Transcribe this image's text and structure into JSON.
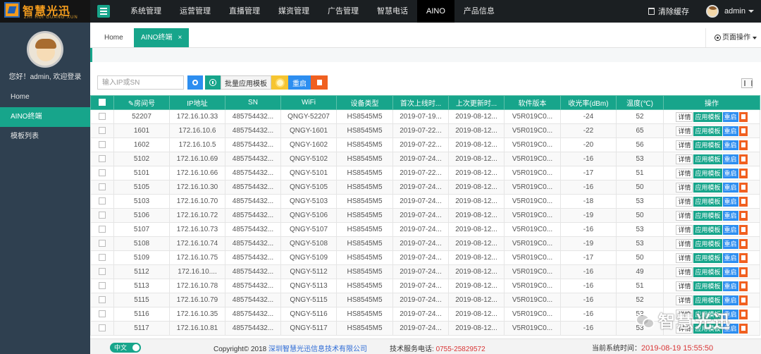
{
  "brand": {
    "name": "智慧光迅",
    "sub": "ZHI HUI GUANG XUN"
  },
  "nav": [
    {
      "label": "系统管理"
    },
    {
      "label": "运营管理"
    },
    {
      "label": "直播管理"
    },
    {
      "label": "媒资管理"
    },
    {
      "label": "广告管理"
    },
    {
      "label": "智慧电话"
    },
    {
      "label": "AINO"
    },
    {
      "label": "产品信息"
    }
  ],
  "nav_active": "AINO",
  "header": {
    "clear_cache": "清除缓存",
    "user": "admin"
  },
  "sidebar": {
    "greeting": "您好！admin, 欢迎登录",
    "items": [
      {
        "label": "Home"
      },
      {
        "label": "AINO终端"
      },
      {
        "label": "模板列表"
      }
    ]
  },
  "tabs": {
    "home": "Home",
    "aino": "AINO终端",
    "close": "×",
    "page_ops": "页面操作"
  },
  "toolbar": {
    "search_placeholder": "输入IP或SN",
    "batch_template": "批量应用模板",
    "reboot": "重启"
  },
  "table": {
    "columns": [
      "房间号",
      "IP地址",
      "SN",
      "WiFi",
      "设备类型",
      "首次上线时...",
      "上次更新时...",
      "软件版本",
      "收光率(dBm)",
      "温度(℃)",
      "操作"
    ],
    "actions": {
      "detail": "详情",
      "apply": "应用模板",
      "reboot": "重启"
    },
    "rows": [
      [
        "52207",
        "172.16.10.33",
        "485754432...",
        "QNGY-52207",
        "HS8545M5",
        "2019-07-19...",
        "2019-08-12...",
        "V5R019C0...",
        "-24",
        "52"
      ],
      [
        "1601",
        "172.16.10.6",
        "485754432...",
        "QNGY-1601",
        "HS8545M5",
        "2019-07-22...",
        "2019-08-12...",
        "V5R019C0...",
        "-22",
        "65"
      ],
      [
        "1602",
        "172.16.10.5",
        "485754432...",
        "QNGY-1602",
        "HS8545M5",
        "2019-07-22...",
        "2019-08-12...",
        "V5R019C0...",
        "-20",
        "56"
      ],
      [
        "5102",
        "172.16.10.69",
        "485754432...",
        "QNGY-5102",
        "HS8545M5",
        "2019-07-24...",
        "2019-08-12...",
        "V5R019C0...",
        "-16",
        "53"
      ],
      [
        "5101",
        "172.16.10.66",
        "485754432...",
        "QNGY-5101",
        "HS8545M5",
        "2019-07-22...",
        "2019-08-12...",
        "V5R019C0...",
        "-17",
        "51"
      ],
      [
        "5105",
        "172.16.10.30",
        "485754432...",
        "QNGY-5105",
        "HS8545M5",
        "2019-07-24...",
        "2019-08-12...",
        "V5R019C0...",
        "-16",
        "50"
      ],
      [
        "5103",
        "172.16.10.70",
        "485754432...",
        "QNGY-5103",
        "HS8545M5",
        "2019-07-24...",
        "2019-08-12...",
        "V5R019C0...",
        "-18",
        "53"
      ],
      [
        "5106",
        "172.16.10.72",
        "485754432...",
        "QNGY-5106",
        "HS8545M5",
        "2019-07-24...",
        "2019-08-12...",
        "V5R019C0...",
        "-19",
        "50"
      ],
      [
        "5107",
        "172.16.10.73",
        "485754432...",
        "QNGY-5107",
        "HS8545M5",
        "2019-07-24...",
        "2019-08-12...",
        "V5R019C0...",
        "-16",
        "53"
      ],
      [
        "5108",
        "172.16.10.74",
        "485754432...",
        "QNGY-5108",
        "HS8545M5",
        "2019-07-24...",
        "2019-08-12...",
        "V5R019C0...",
        "-19",
        "53"
      ],
      [
        "5109",
        "172.16.10.75",
        "485754432...",
        "QNGY-5109",
        "HS8545M5",
        "2019-07-24...",
        "2019-08-12...",
        "V5R019C0...",
        "-17",
        "50"
      ],
      [
        "5112",
        "172.16.10....",
        "485754432...",
        "QNGY-5112",
        "HS8545M5",
        "2019-07-24...",
        "2019-08-12...",
        "V5R019C0...",
        "-16",
        "49"
      ],
      [
        "5113",
        "172.16.10.78",
        "485754432...",
        "QNGY-5113",
        "HS8545M5",
        "2019-07-24...",
        "2019-08-12...",
        "V5R019C0...",
        "-16",
        "51"
      ],
      [
        "5115",
        "172.16.10.79",
        "485754432...",
        "QNGY-5115",
        "HS8545M5",
        "2019-07-24...",
        "2019-08-12...",
        "V5R019C0...",
        "-16",
        "52"
      ],
      [
        "5116",
        "172.16.10.35",
        "485754432...",
        "QNGY-5116",
        "HS8545M5",
        "2019-07-24...",
        "2019-08-12...",
        "V5R019C0...",
        "-16",
        "53"
      ],
      [
        "5117",
        "172.16.10.81",
        "485754432...",
        "QNGY-5117",
        "HS8545M5",
        "2019-07-24...",
        "2019-08-12...",
        "V5R019C0...",
        "-16",
        "53"
      ]
    ]
  },
  "footer": {
    "lang": "中文",
    "copyright_prefix": "Copyright© 2018",
    "company": "深圳智慧光迅信息技术有限公司",
    "support_label": "技术服务电话:",
    "support_phone": "0755-25829572",
    "time_label": "当前系统时间：",
    "time_value": "2019-08-19 15:55:50"
  },
  "watermark": "智慧光迅",
  "colors": {
    "accent": "#17a58b",
    "blue": "#2d8ef0",
    "danger": "#f06020",
    "topbar": "#1b1f22",
    "sidebar": "#2f4050"
  }
}
